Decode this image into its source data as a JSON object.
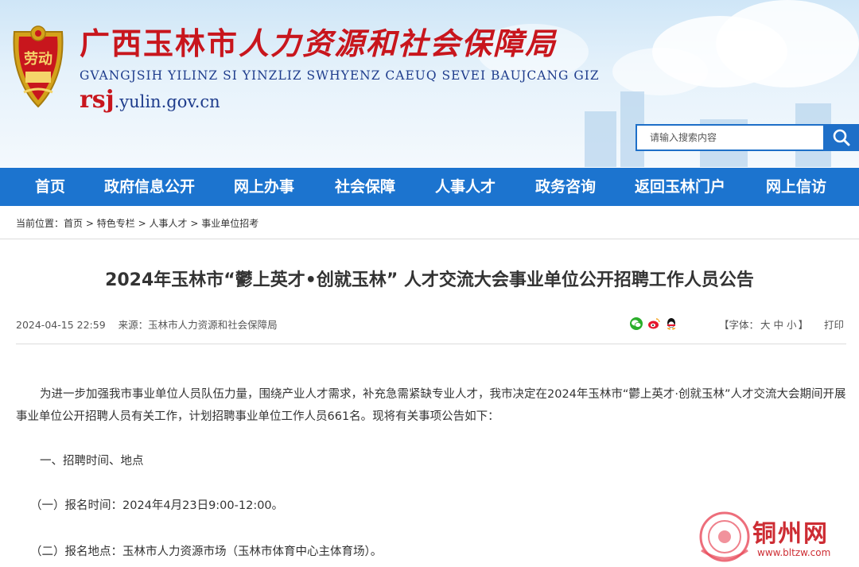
{
  "header": {
    "title_plain": "广西玉林市",
    "title_brush": "人力资源和社会保障局",
    "subtitle_zhuang": "GVANGJSIH YILINZ SI YINZLIZ SWHYENZ CAEUQ SEVEI BAUJCANG GIZ",
    "url_prefix": "rsj",
    "url_suffix": ".yulin.gov.cn",
    "emblem_text": "劳动",
    "search_placeholder": "请输入搜索内容",
    "search_icon": "search-icon"
  },
  "nav": {
    "items": [
      "首页",
      "政府信息公开",
      "网上办事",
      "社会保障",
      "人事人才",
      "政务咨询",
      "返回玉林门户",
      "网上信访"
    ]
  },
  "breadcrumb": {
    "prefix": "当前位置：",
    "items": [
      "首页",
      "特色专栏",
      "人事人才",
      "事业单位招考"
    ],
    "separator": ">"
  },
  "article": {
    "title": "2024年玉林市“鬱上英才•创就玉林” 人才交流大会事业单位公开招聘工作人员公告",
    "date": "2024-04-15 22:59",
    "source": "来源：玉林市人力资源和社会保障局",
    "share_icons": [
      "wechat-icon",
      "weibo-icon",
      "qq-icon"
    ],
    "font_label_open": "【字体：",
    "font_sizes": [
      "大",
      "中",
      "小"
    ],
    "font_label_close": "】",
    "print_label": "打印",
    "paragraphs": [
      "为进一步加强我市事业单位人员队伍力量，围绕产业人才需求，补充急需紧缺专业人才，我市决定在2024年玉林市“鬱上英才·创就玉林”人才交流大会期间开展事业单位公开招聘人员有关工作，计划招聘事业单位工作人员661名。现将有关事项公告如下：",
      "一、招聘时间、地点",
      "（一）报名时间：2024年4月23日9:00-12:00。",
      "（二）报名地点：玉林市人力资源市场（玉林市体育中心主体育场）。"
    ]
  },
  "watermark": {
    "name": "铜州网",
    "url": "www.bltzw.com"
  },
  "colors": {
    "nav_bg": "#1c74cf",
    "brand_red": "#c8161d",
    "brand_blue": "#1e3c8c"
  }
}
